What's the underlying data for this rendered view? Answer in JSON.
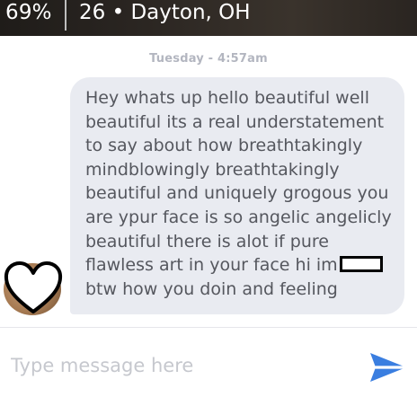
{
  "header": {
    "match_percent": "69%",
    "location": "26 • Dayton, OH"
  },
  "conversation": {
    "timestamp": "Tuesday - 4:57am",
    "messages": [
      {
        "text_before_redaction": "Hey whats up hello beautiful well beautiful its a real understatement to say about how breathtakingly mindblowingly breathtakingly beautiful and uniquely grogous you are ypur face is so angelic angelicly beautiful there is alot if pure flawless art in your face hi im",
        "text_after_redaction": "btw how you doin and feeling"
      }
    ]
  },
  "composer": {
    "placeholder": "Type message here",
    "value": ""
  },
  "colors": {
    "bubble": "#e9ebf1",
    "bubble_text": "#55575e",
    "timestamp": "#b3b6c0",
    "send_accent": "#3a7ee0",
    "placeholder": "#c6c8ce"
  },
  "icons": {
    "send": "send-icon",
    "avatar_overlay": "heart-icon"
  }
}
